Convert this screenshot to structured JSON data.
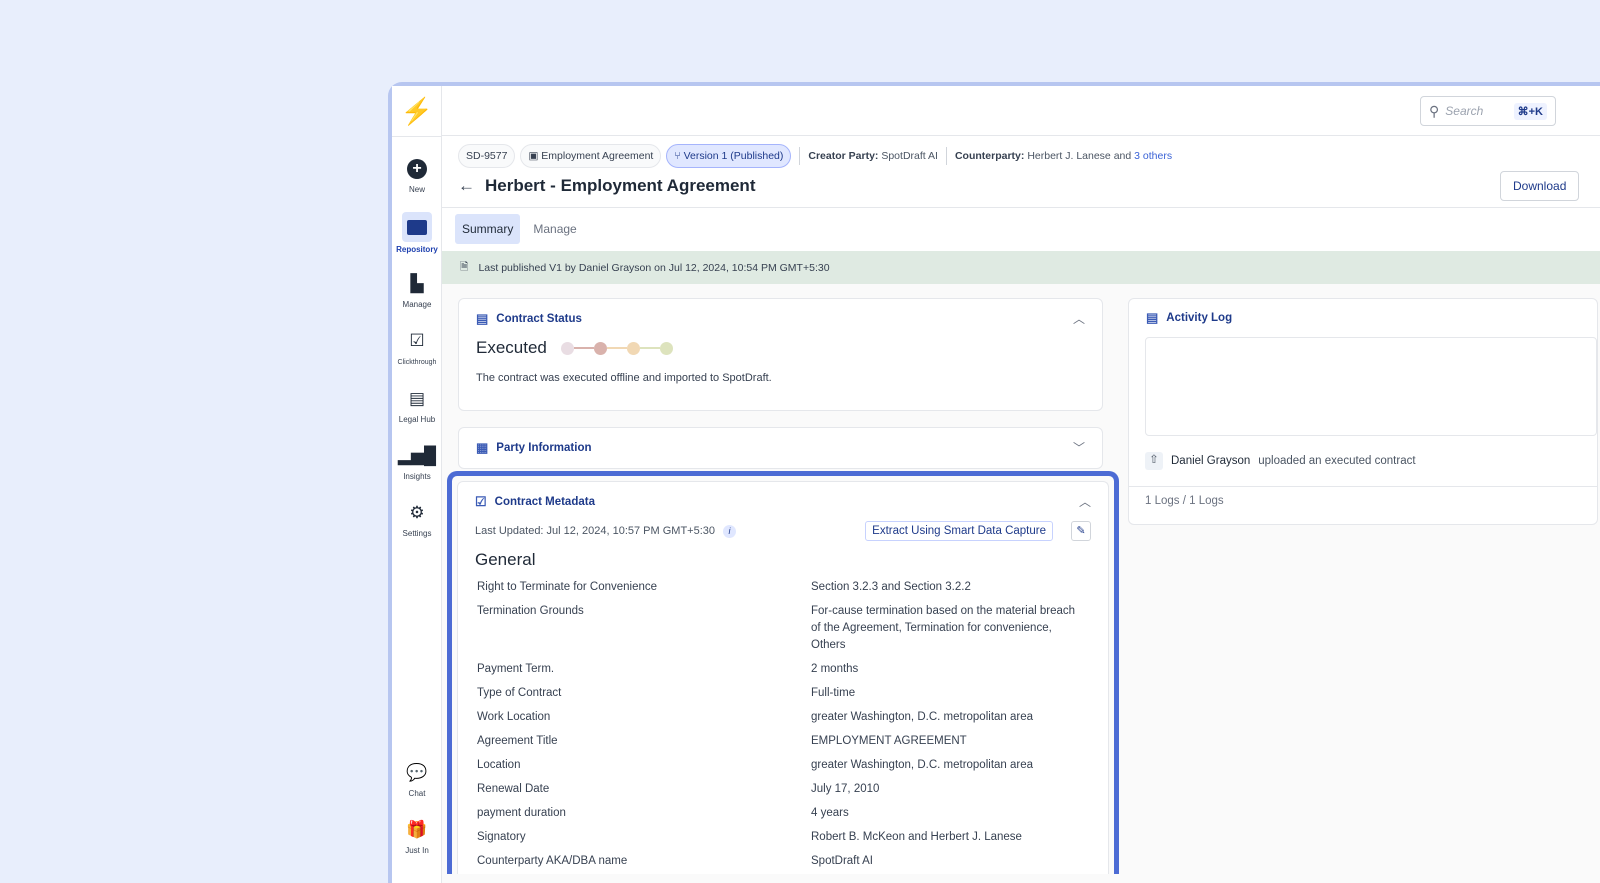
{
  "sidebar": {
    "items": [
      {
        "label": "New",
        "icon": "plus-circle-icon"
      },
      {
        "label": "Repository",
        "icon": "folder-icon"
      },
      {
        "label": "Manage",
        "icon": "manage-icon"
      },
      {
        "label": "Clickthrough",
        "icon": "clickthrough-icon"
      },
      {
        "label": "Legal Hub",
        "icon": "legal-hub-icon"
      },
      {
        "label": "Insights",
        "icon": "bar-chart-icon"
      },
      {
        "label": "Settings",
        "icon": "gear-icon"
      },
      {
        "label": "Chat",
        "icon": "chat-icon"
      },
      {
        "label": "Just In",
        "icon": "gift-icon"
      }
    ]
  },
  "search": {
    "placeholder": "Search",
    "shortcut": "⌘+K"
  },
  "header": {
    "id": "SD-9577",
    "type": "Employment Agreement",
    "version": "Version 1 (Published)",
    "creator_label": "Creator Party:",
    "creator": "SpotDraft AI",
    "counterparty_label": "Counterparty:",
    "counterparty": "Herbert J. Lanese and",
    "others": "3 others",
    "title": "Herbert - Employment Agreement",
    "download": "Download"
  },
  "tabs": [
    "Summary",
    "Manage"
  ],
  "banner": "Last published V1 by Daniel Grayson on Jul 12, 2024, 10:54 PM GMT+5:30",
  "status": {
    "title": "Contract Status",
    "state": "Executed",
    "description": "The contract was executed offline and imported to SpotDraft.",
    "colors": [
      "#e9dde3",
      "#d9b2ac",
      "#f1d8b4",
      "#dde3bd"
    ]
  },
  "party": {
    "title": "Party Information"
  },
  "metadata": {
    "title": "Contract Metadata",
    "last_updated": "Last Updated: Jul 12, 2024, 10:57 PM GMT+5:30",
    "extract": "Extract Using Smart Data Capture",
    "section": "General",
    "rows": [
      [
        "Right to Terminate for Convenience",
        "Section 3.2.3 and Section 3.2.2"
      ],
      [
        "Termination Grounds",
        "For-cause termination based on the material breach of the Agreement, Termination for convenience, Others"
      ],
      [
        "Payment Term.",
        "2 months"
      ],
      [
        "Type of Contract",
        "Full-time"
      ],
      [
        "Work Location",
        "greater Washington, D.C. metropolitan area"
      ],
      [
        "Agreement Title",
        "EMPLOYMENT AGREEMENT"
      ],
      [
        "Location",
        "greater Washington, D.C. metropolitan area"
      ],
      [
        "Renewal Date",
        "July 17, 2010"
      ],
      [
        "payment duration",
        "4 years"
      ],
      [
        "Signatory",
        "Robert B. McKeon and Herbert J. Lanese"
      ],
      [
        "Counterparty AKA/DBA name",
        "SpotDraft AI"
      ]
    ]
  },
  "activity": {
    "title": "Activity Log",
    "user": "Daniel Grayson",
    "action": "uploaded an executed contract",
    "count": "1 Logs / 1 Logs"
  }
}
